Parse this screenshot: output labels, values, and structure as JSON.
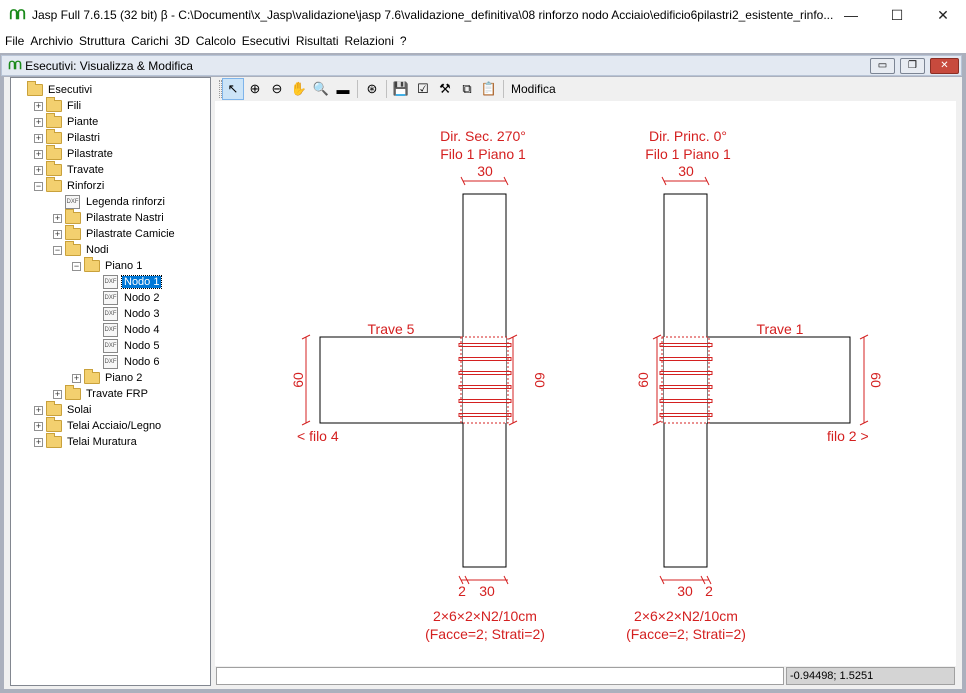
{
  "window": {
    "title": "Jasp Full 7.6.15 (32 bit)  β - C:\\Documenti\\x_Jasp\\validazione\\jasp 7.6\\validazione_definitiva\\08 rinforzo nodo Acciaio\\edificio6pilastri2_esistente_rinfo...",
    "logo": "ՈՈ",
    "minimize": "—",
    "maximize": "☐",
    "close": "✕"
  },
  "menu": [
    "File",
    "Archivio",
    "Struttura",
    "Carichi",
    "3D",
    "Calcolo",
    "Esecutivi",
    "Risultati",
    "Relazioni",
    "?"
  ],
  "child": {
    "title": "Esecutivi: Visualizza & Modifica",
    "logo": "ՈՈ",
    "min": "▭",
    "restore": "❐",
    "close": "✕"
  },
  "tree": [
    {
      "label": "Esecutivi",
      "level": 0,
      "type": "folder",
      "expander": ""
    },
    {
      "label": "Fili",
      "level": 1,
      "type": "folder",
      "expander": "+"
    },
    {
      "label": "Piante",
      "level": 1,
      "type": "folder",
      "expander": "+"
    },
    {
      "label": "Pilastri",
      "level": 1,
      "type": "folder",
      "expander": "+"
    },
    {
      "label": "Pilastrate",
      "level": 1,
      "type": "folder",
      "expander": "+"
    },
    {
      "label": "Travate",
      "level": 1,
      "type": "folder",
      "expander": "+"
    },
    {
      "label": "Rinforzi",
      "level": 1,
      "type": "folder",
      "expander": "-"
    },
    {
      "label": "Legenda rinforzi",
      "level": 2,
      "type": "dxf",
      "expander": ""
    },
    {
      "label": "Pilastrate Nastri",
      "level": 2,
      "type": "folder",
      "expander": "+"
    },
    {
      "label": "Pilastrate Camicie",
      "level": 2,
      "type": "folder",
      "expander": "+"
    },
    {
      "label": "Nodi",
      "level": 2,
      "type": "folder",
      "expander": "-"
    },
    {
      "label": "Piano 1",
      "level": 3,
      "type": "folder",
      "expander": "-"
    },
    {
      "label": "Nodo 1",
      "level": 4,
      "type": "dxf",
      "expander": "",
      "selected": true
    },
    {
      "label": "Nodo 2",
      "level": 4,
      "type": "dxf",
      "expander": ""
    },
    {
      "label": "Nodo 3",
      "level": 4,
      "type": "dxf",
      "expander": ""
    },
    {
      "label": "Nodo 4",
      "level": 4,
      "type": "dxf",
      "expander": ""
    },
    {
      "label": "Nodo 5",
      "level": 4,
      "type": "dxf",
      "expander": ""
    },
    {
      "label": "Nodo 6",
      "level": 4,
      "type": "dxf",
      "expander": ""
    },
    {
      "label": "Piano 2",
      "level": 3,
      "type": "folder",
      "expander": "+"
    },
    {
      "label": "Travate FRP",
      "level": 2,
      "type": "folder",
      "expander": "+"
    },
    {
      "label": "Solai",
      "level": 1,
      "type": "folder",
      "expander": "+"
    },
    {
      "label": "Telai Acciaio/Legno",
      "level": 1,
      "type": "folder",
      "expander": "+"
    },
    {
      "label": "Telai Muratura",
      "level": 1,
      "type": "folder",
      "expander": "+"
    }
  ],
  "dxf_icon": "DXF",
  "toolbar": {
    "tools": [
      {
        "name": "pointer-tool",
        "glyph": "↖",
        "active": true
      },
      {
        "name": "zoom-in-tool",
        "glyph": "⊕"
      },
      {
        "name": "zoom-out-tool",
        "glyph": "⊖"
      },
      {
        "name": "pan-tool",
        "glyph": "✋"
      },
      {
        "name": "zoom-window-tool",
        "glyph": "🔍"
      },
      {
        "name": "measure-tool",
        "glyph": "▬"
      },
      {
        "sep": true
      },
      {
        "name": "zoom-extents-tool",
        "glyph": "⊛"
      },
      {
        "sep": true
      },
      {
        "name": "save-tool",
        "glyph": "💾"
      },
      {
        "name": "edit-tool",
        "glyph": "☑"
      },
      {
        "name": "settings-tool",
        "glyph": "⚒"
      },
      {
        "name": "copy-tool",
        "glyph": "⧉"
      },
      {
        "name": "paste-tool",
        "glyph": "📋"
      },
      {
        "sep": true
      }
    ],
    "modifica_label": "Modifica"
  },
  "drawing": {
    "color": "#d42020",
    "left": {
      "dir_label": "Dir. Sec. 270°",
      "filo_piano": "Filo 1 Piano 1",
      "col_width": "30",
      "beam_label": "Trave 5",
      "beam_height": "60",
      "node_height": "60",
      "filo_arrow": "< filo 4",
      "bottom_offset": "2",
      "bottom_width": "30",
      "rebar_spec": "2×6×2×N2/10cm",
      "rebar_faces": "(Facce=2; Strati=2)"
    },
    "right": {
      "dir_label": "Dir. Princ. 0°",
      "filo_piano": "Filo 1 Piano 1",
      "col_width": "30",
      "beam_label": "Trave 1",
      "beam_height": "60",
      "node_height": "60",
      "filo_arrow": "filo 2 >",
      "bottom_offset": "2",
      "bottom_width": "30",
      "rebar_spec": "2×6×2×N2/10cm",
      "rebar_faces": "(Facce=2; Strati=2)"
    }
  },
  "status": {
    "coords": "-0.94498; 1.5251"
  }
}
